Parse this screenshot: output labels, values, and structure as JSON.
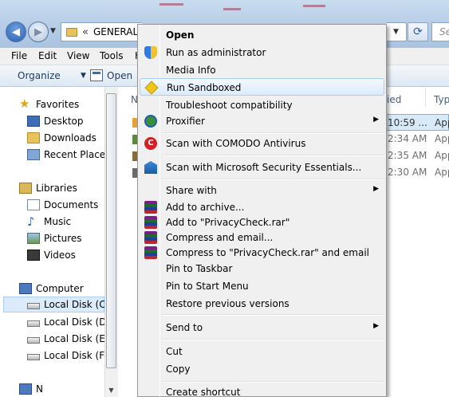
{
  "window": {
    "address": {
      "chevron": "«",
      "path": "GENERAL"
    },
    "search_placeholder": "Se",
    "refresh_glyph": "⟳"
  },
  "menubar": [
    "File",
    "Edit",
    "View",
    "Tools",
    "H"
  ],
  "toolbar": {
    "organize": "Organize",
    "open": "Open"
  },
  "navigation": {
    "favorites": {
      "label": "Favorites",
      "items": [
        "Desktop",
        "Downloads",
        "Recent Places"
      ]
    },
    "libraries": {
      "label": "Libraries",
      "items": [
        "Documents",
        "Music",
        "Pictures",
        "Videos"
      ]
    },
    "computer": {
      "label": "Computer",
      "items": [
        "Local Disk (C:)",
        "Local Disk (D:)",
        "Local Disk (E:)",
        "Local Disk (F:)"
      ]
    },
    "network_label_partial": "N"
  },
  "file_list": {
    "columns": {
      "name_partial": "N",
      "modified_partial": "ied",
      "type_partial": "Typ"
    },
    "rows": [
      {
        "time": "10:59 ...",
        "type": "App"
      },
      {
        "time": "2:34 AM",
        "type": "App"
      },
      {
        "time": "2:35 AM",
        "type": "App"
      },
      {
        "time": "2:30 AM",
        "type": "App"
      }
    ],
    "status_partial": "'''"
  },
  "context_menu": {
    "items": [
      {
        "label": "Open",
        "bold": true
      },
      {
        "label": "Run as administrator",
        "icon": "uac-shield-icon"
      },
      {
        "label": "Media Info"
      },
      {
        "label": "Run Sandboxed",
        "icon": "sandbox-icon",
        "highlighted": true
      },
      {
        "label": "Troubleshoot compatibility"
      },
      {
        "label": "Proxifier",
        "icon": "proxifier-icon",
        "submenu": true
      },
      {
        "label": "Scan with COMODO Antivirus",
        "icon": "comodo-icon"
      },
      {
        "label": "Scan with Microsoft Security Essentials...",
        "icon": "mse-icon"
      },
      {
        "label": "Share with",
        "submenu": true
      },
      {
        "label": "Add to archive...",
        "icon": "winrar-icon"
      },
      {
        "label": "Add to \"PrivacyCheck.rar\"",
        "icon": "winrar-icon"
      },
      {
        "label": "Compress and email...",
        "icon": "winrar-icon"
      },
      {
        "label": "Compress to \"PrivacyCheck.rar\" and email",
        "icon": "winrar-icon"
      },
      {
        "label": "Pin to Taskbar"
      },
      {
        "label": "Pin to Start Menu"
      },
      {
        "label": "Restore previous versions"
      },
      {
        "label": "Send to",
        "submenu": true
      },
      {
        "label": "Cut"
      },
      {
        "label": "Copy"
      },
      {
        "label": "Create shortcut",
        "partially_visible": true
      }
    ],
    "submenu_arrow": "▶",
    "comodo_glyph": "C"
  }
}
